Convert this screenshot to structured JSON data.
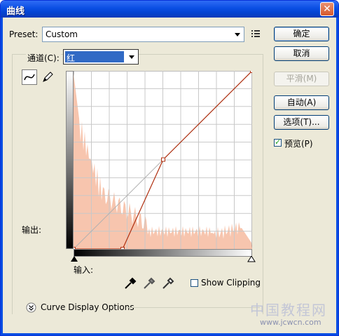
{
  "window": {
    "title": "曲线",
    "close_glyph": "✕"
  },
  "preset": {
    "label": "Preset:",
    "value": "Custom",
    "options_icon": "preset-options-icon"
  },
  "channel": {
    "label": "通道(C):",
    "value": "红"
  },
  "tools": {
    "curve_tool": "curve-point-icon",
    "pencil_tool": "pencil-icon"
  },
  "labels": {
    "output": "输出:",
    "input": "输入:",
    "show_clipping": "Show Clipping",
    "curve_display_options": "Curve Display Options"
  },
  "buttons": {
    "ok": "确定",
    "cancel": "取消",
    "smooth": "平滑(M)",
    "auto": "自动(A)",
    "options": "选项(T)..."
  },
  "preview": {
    "label": "预览(P)",
    "checked": true
  },
  "show_clipping_checked": false,
  "watermark": {
    "text": "中国教程网",
    "url": "www.jcwcn.com"
  },
  "chart_data": {
    "type": "line",
    "series": [
      {
        "values": [
          [
            0,
            0
          ],
          [
            70,
            0
          ],
          [
            128,
            128
          ],
          [
            255,
            255
          ]
        ]
      }
    ],
    "xlim": [
      0,
      255
    ],
    "ylim": [
      0,
      255
    ],
    "grid": true,
    "gridlines": 10
  },
  "colors": {
    "histogram": "#f7c5ae",
    "curve": "#b03010",
    "titlebar": "#0a4ee3"
  }
}
